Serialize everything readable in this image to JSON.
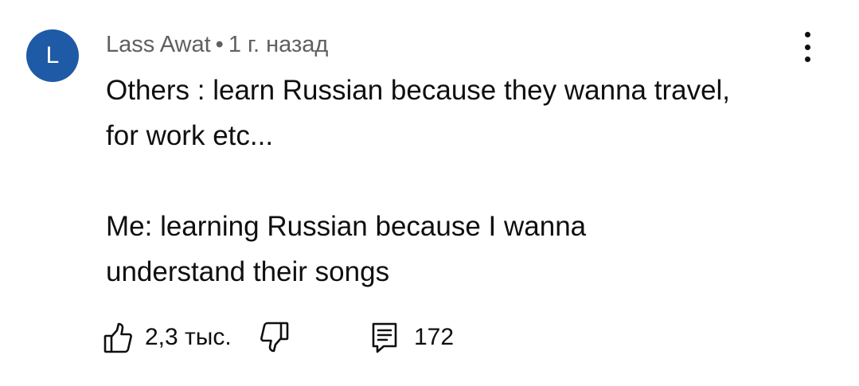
{
  "comment": {
    "avatar_letter": "L",
    "avatar_color": "#1f5aa6",
    "author": "Lass Awat",
    "separator": "•",
    "time_ago": "1 г. назад",
    "text": "Others : learn Russian because they wanna travel,\nfor work etc...\n\nMe: learning Russian because I wanna\nunderstand their songs",
    "likes": "2,3 тыс.",
    "replies": "172",
    "icons": {
      "more": "more-vert-icon",
      "like": "thumbs-up-icon",
      "dislike": "thumbs-down-icon",
      "reply": "comment-icon"
    }
  }
}
